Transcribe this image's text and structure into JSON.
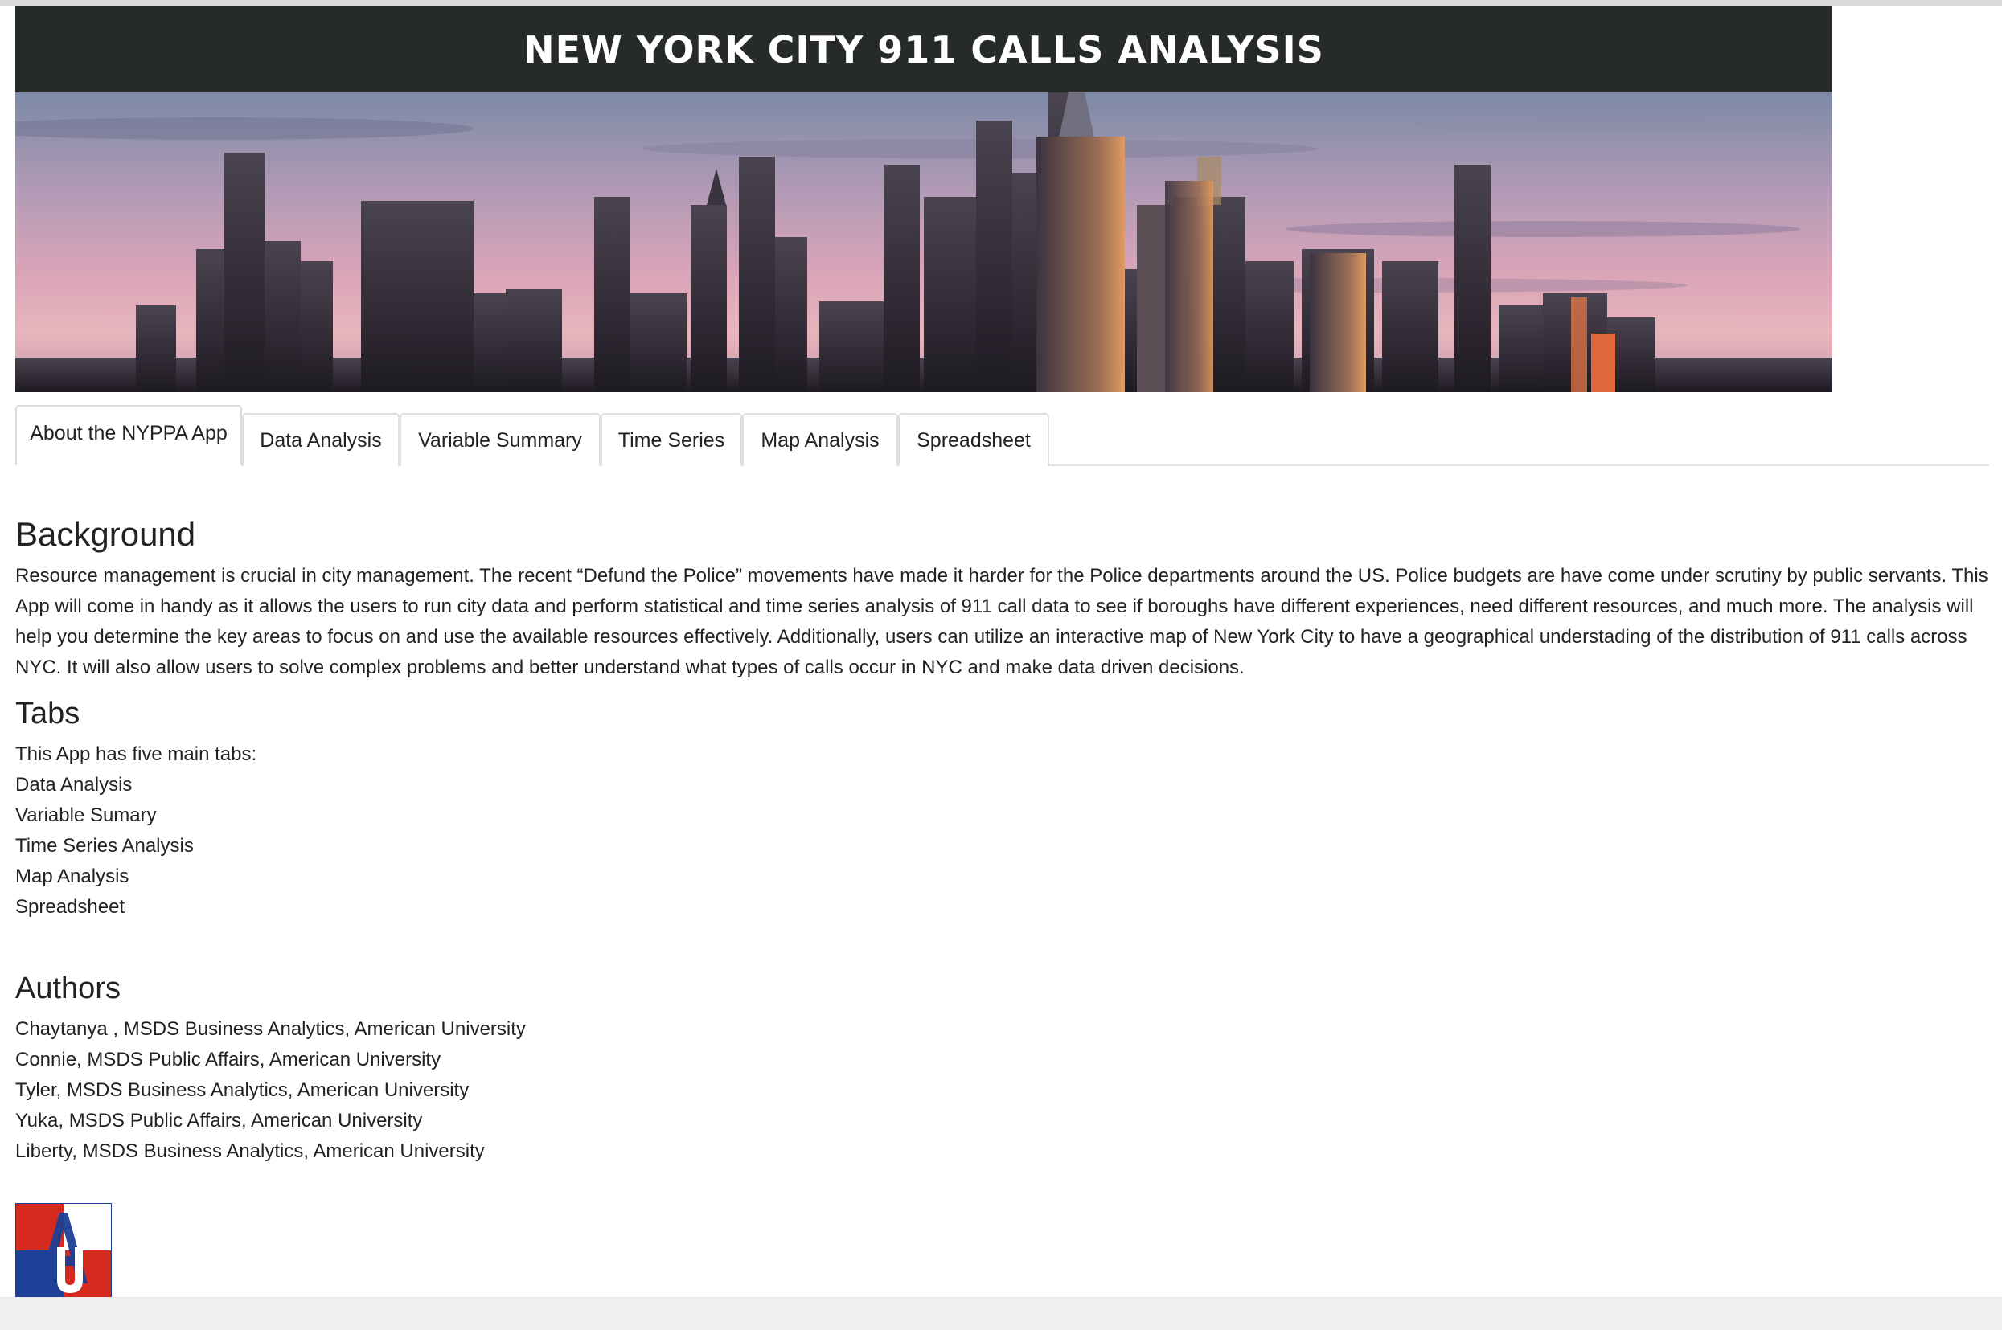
{
  "banner": {
    "title": "NEW YORK CITY 911 CALLS ANALYSIS"
  },
  "tabs": [
    {
      "label": "About the NYPPA App",
      "active": true
    },
    {
      "label": "Data Analysis",
      "active": false
    },
    {
      "label": "Variable Summary",
      "active": false
    },
    {
      "label": "Time Series",
      "active": false
    },
    {
      "label": "Map Analysis",
      "active": false
    },
    {
      "label": "Spreadsheet",
      "active": false
    }
  ],
  "background": {
    "heading": "Background",
    "text": "Resource management is crucial in city management. The recent “Defund the Police” movements have made it harder for the Police departments around the US. Police budgets are have come under scrutiny by public servants. This App will come in handy as it allows the users to run city data and perform statistical and time series analysis of 911 call data to see if boroughs have different experiences, need different resources, and much more. The analysis will help you determine the key areas to focus on and use the available resources effectively. Additionally, users can utilize an interactive map of New York City to have a geographical understading of the distribution of 911 calls across NYC. It will also allow users to solve complex problems and better understand what types of calls occur in NYC and make data driven decisions."
  },
  "tabs_section": {
    "heading": "Tabs",
    "intro": "This App has five main tabs:",
    "items": [
      "Data Analysis",
      "Variable Sumary",
      "Time Series Analysis",
      "Map Analysis",
      "Spreadsheet"
    ]
  },
  "authors": {
    "heading": "Authors",
    "items": [
      "Chaytanya , MSDS Business Analytics, American University",
      "Connie, MSDS Public Affairs, American University",
      "Tyler, MSDS Business Analytics, American University",
      "Yuka, MSDS Public Affairs, American University",
      "Liberty, MSDS Business Analytics, American University"
    ]
  },
  "logo": {
    "letters": "AU",
    "colors": {
      "red": "#d52b1e",
      "blue": "#1e3f96"
    }
  },
  "colors": {
    "banner_bar": "#262a29",
    "tab_border": "#dfdfdf"
  }
}
